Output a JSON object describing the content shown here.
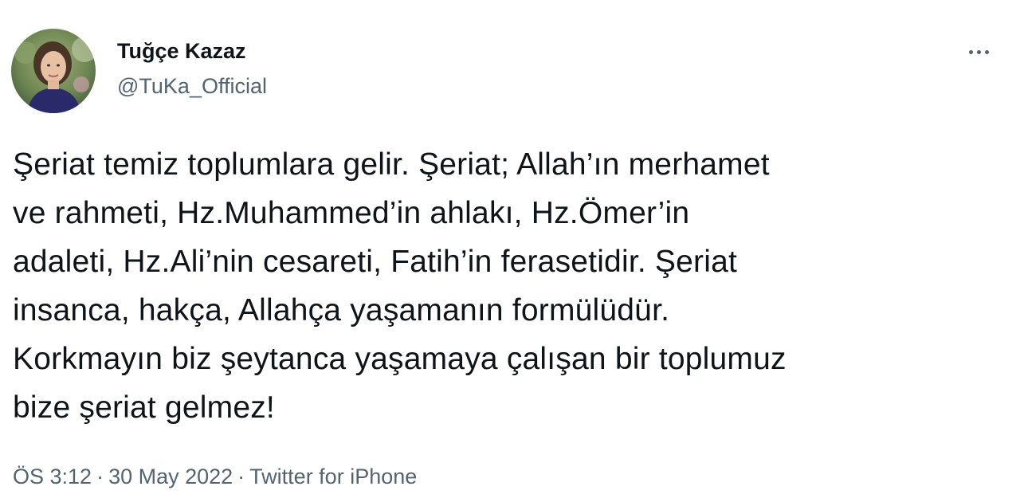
{
  "author": {
    "display_name": "Tuğçe Kazaz",
    "handle": "@TuKa_Official"
  },
  "tweet": {
    "lines": [
      "Şeriat temiz toplumlara gelir. Şeriat; Allah’ın merhamet",
      "ve rahmeti, Hz.Muhammed’in ahlakı, Hz.Ömer’in",
      "adaleti, Hz.Ali’nin cesareti, Fatih’in ferasetidir. Şeriat",
      "insanca, hakça, Allahça yaşamanın formülüdür.",
      "Korkmayın biz şeytanca yaşamaya çalışan bir toplumuz",
      "bize şeriat gelmez!"
    ]
  },
  "meta": {
    "time": "ÖS 3:12",
    "separator": "·",
    "date": "30 May 2022",
    "source": "Twitter for iPhone"
  },
  "icons": {
    "more": "more-horizontal-icon",
    "avatar": "profile-photo"
  },
  "colors": {
    "text": "#0f1419",
    "secondary": "#536471",
    "background": "#ffffff"
  }
}
